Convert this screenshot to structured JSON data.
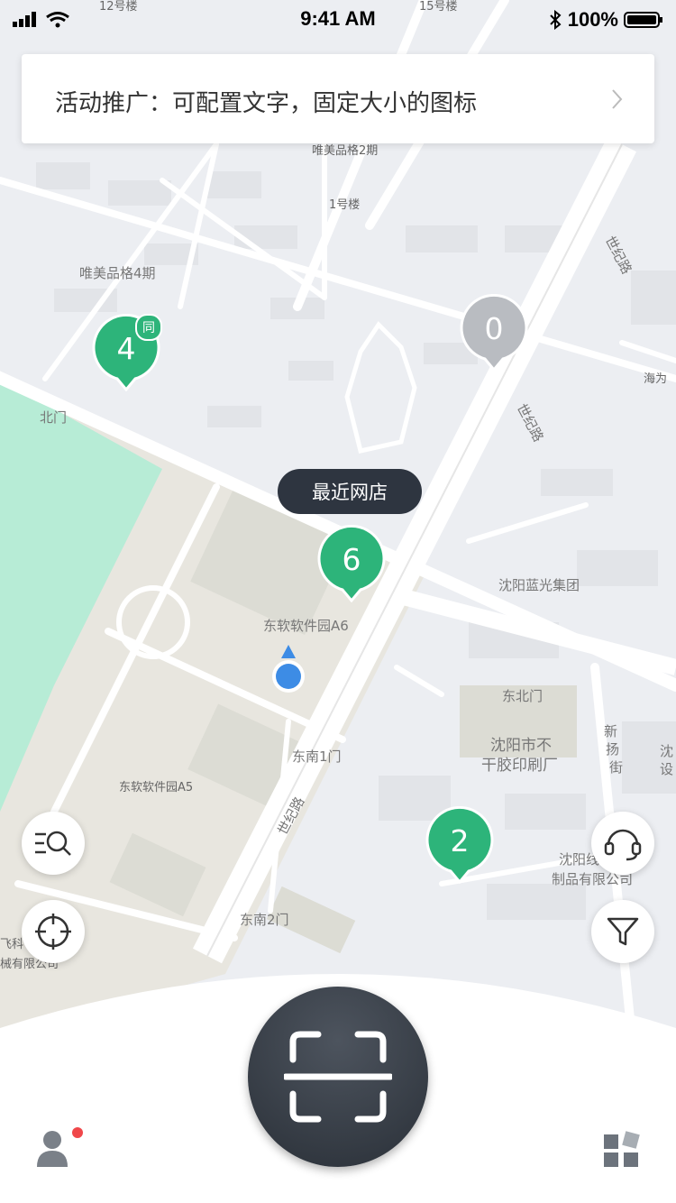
{
  "status_bar": {
    "time": "9:41 AM",
    "battery": "100%"
  },
  "banner": {
    "text": "活动推广：可配置文字，固定大小的图标"
  },
  "map_labels": {
    "weimei2": "唯美品格2期",
    "building1": "1号楼",
    "weimei4": "唯美品格4期",
    "beimen": "北门",
    "a6": "东软软件园A6",
    "a5": "东软软件园A5",
    "southeast1": "东南1门",
    "southeast2": "东南2门",
    "northeast": "东北门",
    "languang": "沈阳蓝光集团",
    "factory_l1": "沈阳市不",
    "factory_l2": "干胶印刷厂",
    "company_l1": "沈阳线",
    "company_l2": "制品有限公司",
    "haiwei": "海为",
    "road_shiji_1": "世纪路",
    "road_shiji_2": "世纪路",
    "road_shiji_3": "世纪路",
    "xinyang_1": "新",
    "xinyang_2": "扬",
    "xinyang_3": "街",
    "edge_1": "飞科",
    "edge_2": "械有限公司",
    "edge_right_1": "沈",
    "edge_right_2": "设",
    "top_12": "12号楼",
    "top_15": "15号楼"
  },
  "pins": [
    {
      "count": "4",
      "badge": "同",
      "color": "#2db47a"
    },
    {
      "count": "0",
      "color": "#b9bcc1"
    },
    {
      "count": "6",
      "color": "#2db47a"
    },
    {
      "count": "2",
      "color": "#2db47a"
    }
  ],
  "nearest_tip": "最近网店",
  "colors": {
    "green": "#2db47a",
    "park": "#b7ecd6",
    "dark": "#2e3540",
    "alert": "#f0474a"
  },
  "icons": [
    "search-list-icon",
    "locate-icon",
    "headset-icon",
    "filter-icon",
    "scan-icon",
    "user-icon",
    "apps-icon"
  ]
}
